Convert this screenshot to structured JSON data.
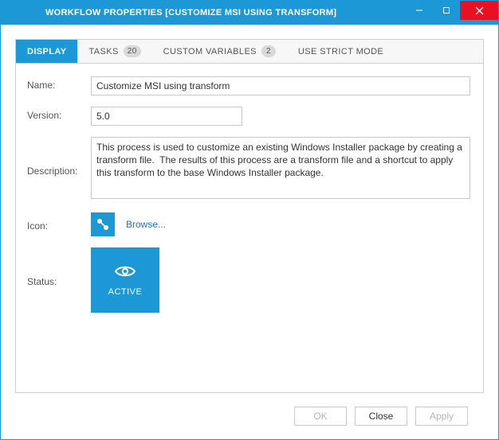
{
  "window": {
    "title": "WORKFLOW PROPERTIES [CUSTOMIZE MSI USING TRANSFORM]"
  },
  "tabs": {
    "display": "DISPLAY",
    "tasks": "TASKS",
    "tasks_count": "20",
    "custom_vars": "CUSTOM VARIABLES",
    "custom_vars_count": "2",
    "strict": "USE STRICT MODE"
  },
  "form": {
    "name_label": "Name:",
    "name_value": "Customize MSI using transform",
    "version_label": "Version:",
    "version_value": "5.0",
    "description_label": "Description:",
    "description_value": "This process is used to customize an existing Windows Installer package by creating a transform file.  The results of this process are a transform file and a shortcut to apply this transform to the base Windows Installer package.",
    "icon_label": "Icon:",
    "browse_label": "Browse...",
    "status_label": "Status:",
    "status_value": "ACTIVE"
  },
  "footer": {
    "ok": "OK",
    "close": "Close",
    "apply": "Apply"
  }
}
